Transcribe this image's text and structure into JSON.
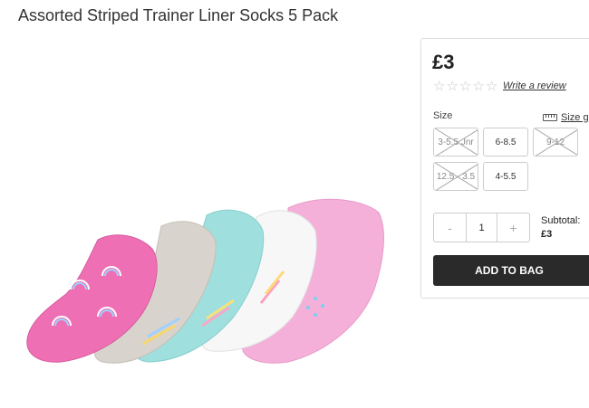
{
  "product": {
    "title": "Assorted Striped Trainer Liner Socks 5 Pack",
    "price": "£3"
  },
  "rating": {
    "stars_filled": 0,
    "stars_total": 5,
    "review_link": "Write a review"
  },
  "size": {
    "label": "Size",
    "guide_link": "Size g",
    "options": [
      {
        "label": "3-5.5 Jnr",
        "available": false
      },
      {
        "label": "6-8.5",
        "available": true
      },
      {
        "label": "9-12",
        "available": false
      },
      {
        "label": "12.5 - 3.5",
        "available": false
      },
      {
        "label": "4-5.5",
        "available": true
      }
    ]
  },
  "quantity": {
    "minus": "-",
    "value": "1",
    "plus": "+"
  },
  "subtotal": {
    "label": "Subtotal:",
    "value": "£3"
  },
  "actions": {
    "add_to_bag": "ADD TO BAG"
  },
  "colors": {
    "button_bg": "#2a2a2a",
    "sock_pink": "#ee6fb4",
    "sock_grey": "#d8d3cc",
    "sock_aqua": "#9fe0de",
    "sock_white": "#f7f7f7",
    "sock_light_pink": "#f4b0d8"
  }
}
